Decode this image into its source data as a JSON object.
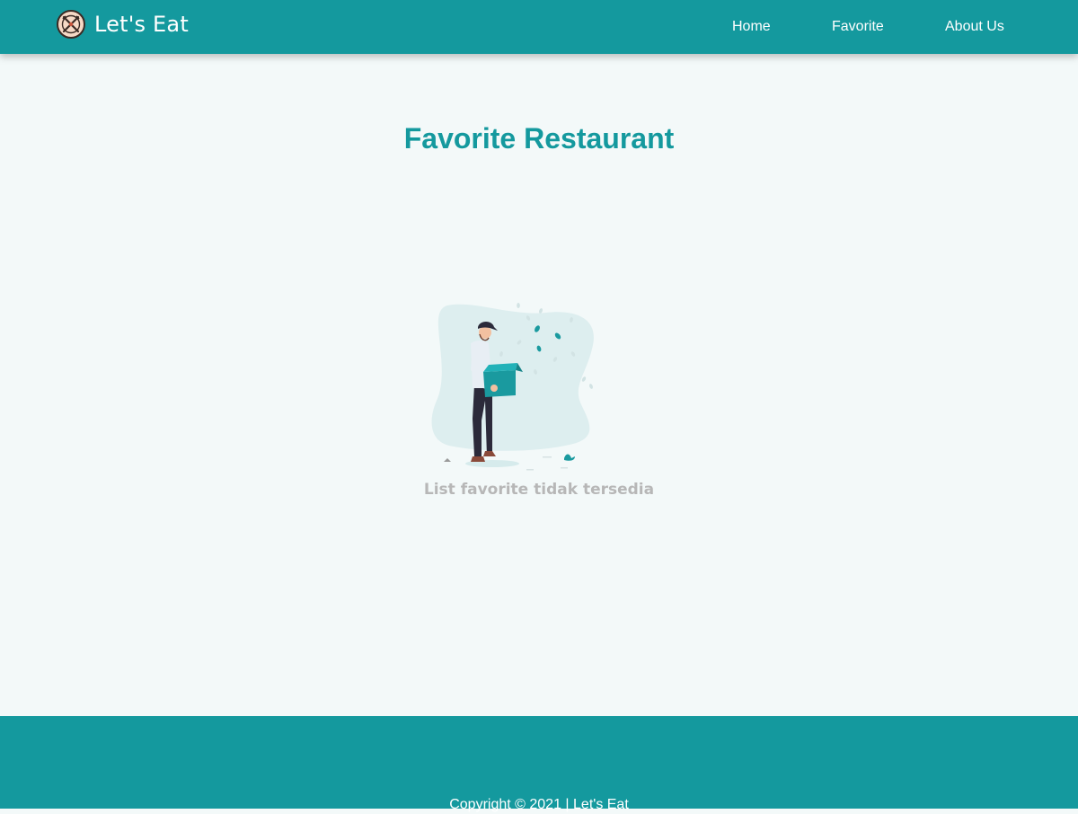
{
  "header": {
    "brand": {
      "name": "Let's Eat",
      "logo_icon": "fork-knife-plate-icon"
    },
    "nav": [
      {
        "label": "Home"
      },
      {
        "label": "Favorite"
      },
      {
        "label": "About Us"
      }
    ]
  },
  "main": {
    "title": "Favorite Restaurant",
    "empty_state": {
      "illustration": "empty-box-person-illustration",
      "message": "List favorite tidak tersedia"
    }
  },
  "footer": {
    "copyright": "Copyright © 2021 | Let's Eat"
  },
  "colors": {
    "primary": "#14999e",
    "background": "#f3f9f9",
    "muted_text": "#b7b7b7"
  }
}
